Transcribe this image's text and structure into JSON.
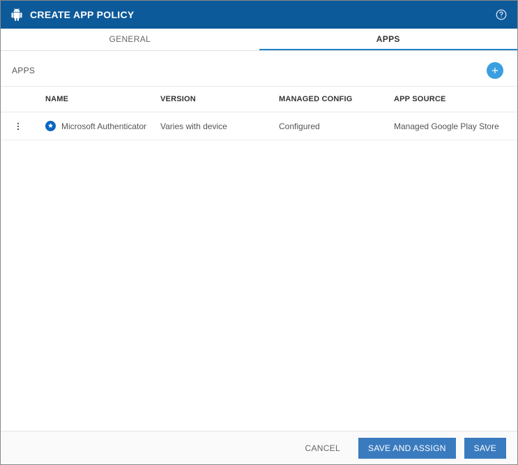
{
  "header": {
    "title": "CREATE APP POLICY"
  },
  "tabs": [
    {
      "label": "GENERAL",
      "active": false
    },
    {
      "label": "APPS",
      "active": true
    }
  ],
  "section": {
    "title": "APPS"
  },
  "table": {
    "headers": {
      "name": "NAME",
      "version": "VERSION",
      "managed": "MANAGED CONFIG",
      "source": "APP SOURCE"
    },
    "rows": [
      {
        "name": "Microsoft Authenticator",
        "version": "Varies with device",
        "managed": "Configured",
        "source": "Managed Google Play Store"
      }
    ]
  },
  "footer": {
    "cancel": "CANCEL",
    "save_assign": "SAVE AND ASSIGN",
    "save": "SAVE"
  }
}
